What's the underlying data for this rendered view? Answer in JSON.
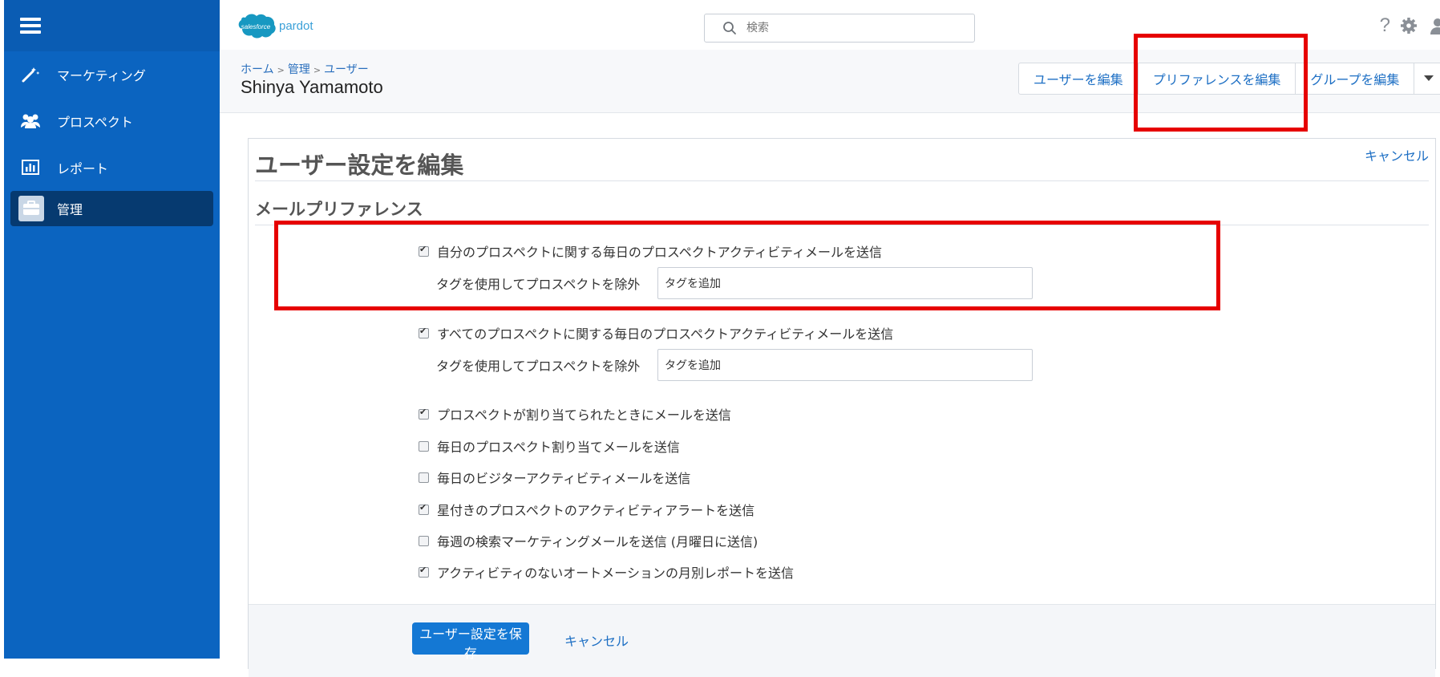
{
  "app": {
    "logo_text": "salesforce",
    "product": "pardot"
  },
  "search": {
    "placeholder": "検索"
  },
  "sidebar": {
    "items": [
      {
        "label": "マーケティング",
        "icon": "magic-wand-icon"
      },
      {
        "label": "プロスペクト",
        "icon": "people-icon"
      },
      {
        "label": "レポート",
        "icon": "report-chart-icon"
      },
      {
        "label": "管理",
        "icon": "briefcase-icon",
        "active": true
      }
    ]
  },
  "header": {
    "help": "?"
  },
  "breadcrumb": [
    "ホーム",
    "管理",
    "ユーザー"
  ],
  "page": {
    "title": "Shinya Yamamoto"
  },
  "actions": [
    "ユーザーを編集",
    "プリファレンスを編集",
    "グループを編集"
  ],
  "form": {
    "title": "ユーザー設定を編集",
    "cancel_top": "キャンセル",
    "section": "メールプリファレンス",
    "options": [
      {
        "label": "自分のプロスペクトに関する毎日のプロスペクトアクティビティメールを送信",
        "checked": true
      },
      {
        "label": "すべてのプロスペクトに関する毎日のプロスペクトアクティビティメールを送信",
        "checked": true
      },
      {
        "label": "プロスペクトが割り当てられたときにメールを送信",
        "checked": true
      },
      {
        "label": "毎日のプロスペクト割り当てメールを送信",
        "checked": false
      },
      {
        "label": "毎日のビジターアクティビティメールを送信",
        "checked": false
      },
      {
        "label": "星付きのプロスペクトのアクティビティアラートを送信",
        "checked": true
      },
      {
        "label": "毎週の検索マーケティングメールを送信 (月曜日に送信)",
        "checked": false
      },
      {
        "label": "アクティビティのないオートメーションの月別レポートを送信",
        "checked": true
      }
    ],
    "tag_label": "タグを使用してプロスペクトを除外",
    "tag_input": "タグを追加",
    "save": "ユーザー設定を保存",
    "cancel_bottom": "キャンセル"
  },
  "colors": {
    "sidebar": "#0b64c0",
    "active": "#063a70",
    "link": "#1d6fc4",
    "primary_button": "#1478d4",
    "highlight": "#e60000"
  }
}
